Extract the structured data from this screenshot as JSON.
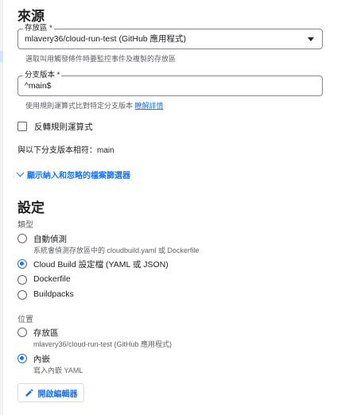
{
  "source": {
    "heading": "來源",
    "repository": {
      "label": "存放區 *",
      "value": "mlavery36/cloud-run-test (GitHub 應用程式)",
      "helper": "選取叫用觸發條件時要監控事件及複製的存放區"
    },
    "branch": {
      "label": "分支版本 *",
      "value": "^main$",
      "helper": "使用規則運算式比對特定分支版本",
      "learn_more": "瞭解詳情"
    },
    "invert_regex_label": "反轉規則運算式",
    "matched_branch_text": "與以下分支版本相符：main",
    "show_filters_label": "顯示納入和忽略的檔案篩選器"
  },
  "settings": {
    "heading": "設定",
    "type_label": "類型",
    "type_options": [
      {
        "label": "自動偵測",
        "description": "系統會偵測存放區中的 cloudbuild.yaml 或 Dockerfile",
        "selected": false
      },
      {
        "label": "Cloud Build 設定檔 (YAML 或 JSON)",
        "description": "",
        "selected": true
      },
      {
        "label": "Dockerfile",
        "description": "",
        "selected": false
      },
      {
        "label": "Buildpacks",
        "description": "",
        "selected": false
      }
    ],
    "location_label": "位置",
    "location_options": [
      {
        "label": "存放區",
        "description": "mlavery36/cloud-run-test (GitHub 應用程式)",
        "selected": false
      },
      {
        "label": "內嵌",
        "description": "寫入內嵌 YAML",
        "selected": true
      }
    ],
    "open_editor_label": "開啟編輯器"
  },
  "colors": {
    "accent": "#1a73e8",
    "text": "#202124",
    "secondary_text": "#5f6368"
  },
  "icons": [
    "dropdown-caret-icon",
    "chevron-down-icon",
    "pencil-icon"
  ]
}
